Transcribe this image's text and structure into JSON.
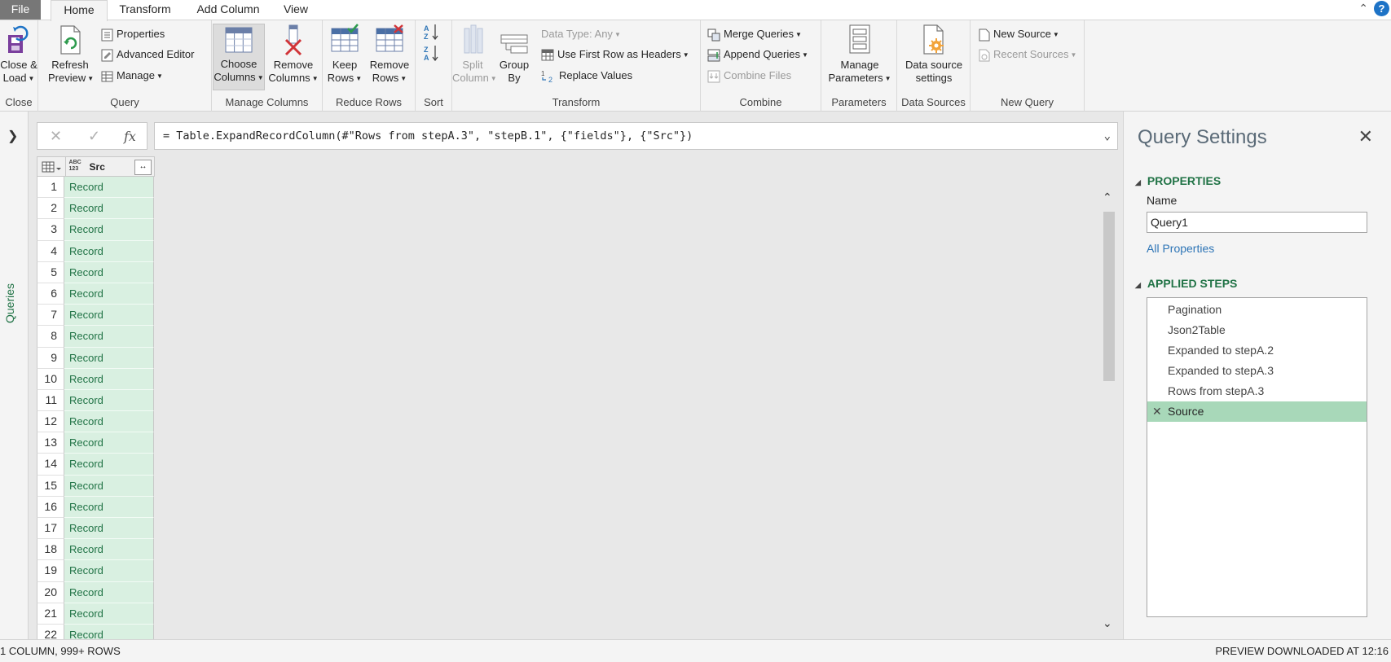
{
  "tabs": {
    "file": "File",
    "home": "Home",
    "transform": "Transform",
    "add_column": "Add Column",
    "view": "View"
  },
  "ribbon": {
    "close": {
      "label": "Close",
      "close_load": [
        "Close &",
        "Load"
      ]
    },
    "query": {
      "label": "Query",
      "refresh_preview": [
        "Refresh",
        "Preview"
      ],
      "properties": "Properties",
      "advanced_editor": "Advanced Editor",
      "manage": "Manage"
    },
    "manage_columns": {
      "label": "Manage Columns",
      "choose_columns": [
        "Choose",
        "Columns"
      ],
      "remove_columns": [
        "Remove",
        "Columns"
      ]
    },
    "reduce_rows": {
      "label": "Reduce Rows",
      "keep_rows": [
        "Keep",
        "Rows"
      ],
      "remove_rows": [
        "Remove",
        "Rows"
      ]
    },
    "sort": {
      "label": "Sort"
    },
    "transform": {
      "label": "Transform",
      "split_column": [
        "Split",
        "Column"
      ],
      "group_by": [
        "Group",
        "By"
      ],
      "data_type": "Data Type: Any",
      "use_first_row": "Use First Row as Headers",
      "replace_values": "Replace Values"
    },
    "combine": {
      "label": "Combine",
      "merge_queries": "Merge Queries",
      "append_queries": "Append Queries",
      "combine_files": "Combine Files"
    },
    "parameters": {
      "label": "Parameters",
      "manage_parameters": [
        "Manage",
        "Parameters"
      ]
    },
    "data_sources": {
      "label": "Data Sources",
      "data_source_settings": [
        "Data source",
        "settings"
      ]
    },
    "new_query": {
      "label": "New Query",
      "new_source": "New Source",
      "recent_sources": "Recent Sources"
    }
  },
  "queries_pane": {
    "label": "Queries"
  },
  "formula_bar": {
    "fx": "fx",
    "formula": "= Table.ExpandRecordColumn(#\"Rows from stepA.3\", \"stepB.1\", {\"fields\"}, {\"Src\"})"
  },
  "grid": {
    "type_icon_top": "ABC",
    "type_icon_bottom": "123",
    "column_name": "Src",
    "rows": [
      {
        "n": "1",
        "v": "Record"
      },
      {
        "n": "2",
        "v": "Record"
      },
      {
        "n": "3",
        "v": "Record"
      },
      {
        "n": "4",
        "v": "Record"
      },
      {
        "n": "5",
        "v": "Record"
      },
      {
        "n": "6",
        "v": "Record"
      },
      {
        "n": "7",
        "v": "Record"
      },
      {
        "n": "8",
        "v": "Record"
      },
      {
        "n": "9",
        "v": "Record"
      },
      {
        "n": "10",
        "v": "Record"
      },
      {
        "n": "11",
        "v": "Record"
      },
      {
        "n": "12",
        "v": "Record"
      },
      {
        "n": "13",
        "v": "Record"
      },
      {
        "n": "14",
        "v": "Record"
      },
      {
        "n": "15",
        "v": "Record"
      },
      {
        "n": "16",
        "v": "Record"
      },
      {
        "n": "17",
        "v": "Record"
      },
      {
        "n": "18",
        "v": "Record"
      },
      {
        "n": "19",
        "v": "Record"
      },
      {
        "n": "20",
        "v": "Record"
      },
      {
        "n": "21",
        "v": "Record"
      },
      {
        "n": "22",
        "v": "Record"
      }
    ]
  },
  "query_settings": {
    "title": "Query Settings",
    "properties_heading": "PROPERTIES",
    "name_label": "Name",
    "name_value": "Query1",
    "all_properties": "All Properties",
    "applied_steps_heading": "APPLIED STEPS",
    "steps": [
      {
        "label": "Pagination",
        "selected": false
      },
      {
        "label": "Json2Table",
        "selected": false
      },
      {
        "label": "Expanded to stepA.2",
        "selected": false
      },
      {
        "label": "Expanded to stepA.3",
        "selected": false
      },
      {
        "label": "Rows from stepA.3",
        "selected": false
      },
      {
        "label": "Source",
        "selected": true
      }
    ]
  },
  "status_bar": {
    "left": "1 COLUMN, 999+ ROWS",
    "right": "PREVIEW DOWNLOADED AT 12:16"
  },
  "colors": {
    "accent_green": "#217346",
    "record_cell_bg": "#d9f0e1",
    "selected_step_bg": "#a8d8b9",
    "help_blue": "#1e73c6"
  }
}
